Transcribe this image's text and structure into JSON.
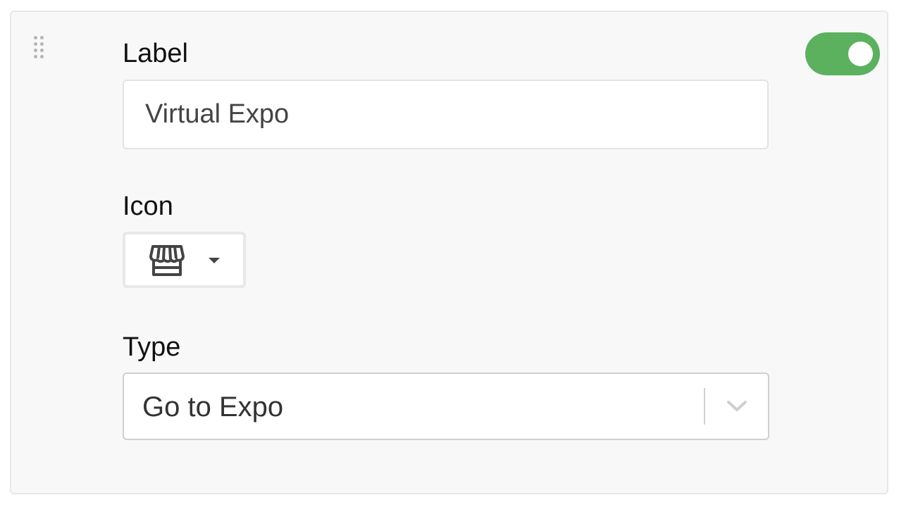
{
  "form": {
    "label_heading": "Label",
    "label_value": "Virtual Expo",
    "icon_heading": "Icon",
    "icon_selected": "store-icon",
    "type_heading": "Type",
    "type_value": "Go to Expo"
  },
  "toggle": {
    "enabled": true
  },
  "colors": {
    "toggle_on": "#5bb15e",
    "card_background": "#f8f8f8",
    "icon_stroke": "#444444"
  }
}
